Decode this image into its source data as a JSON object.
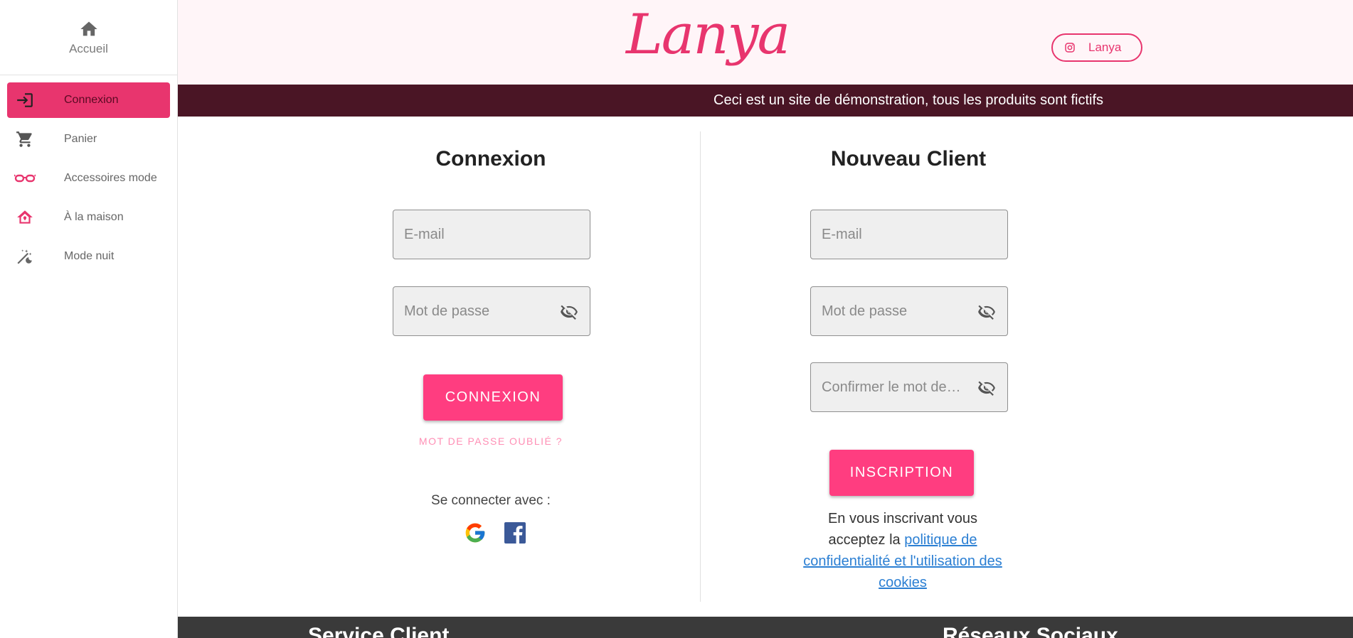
{
  "sidebar": {
    "home_label": "Accueil",
    "items": [
      {
        "label": "Connexion",
        "icon": "login-icon"
      },
      {
        "label": "Panier",
        "icon": "cart-icon"
      },
      {
        "label": "Accessoires mode",
        "icon": "glasses-icon"
      },
      {
        "label": "À la maison",
        "icon": "house-icon"
      },
      {
        "label": "Mode nuit",
        "icon": "night-mode-icon"
      }
    ]
  },
  "header": {
    "logo": "Lanya",
    "instagram_label": "Lanya",
    "banner": "Ceci est un site de démonstration, tous les produits sont fictifs"
  },
  "login": {
    "title": "Connexion",
    "email_placeholder": "E-mail",
    "password_placeholder": "Mot de passe",
    "submit_label": "CONNEXION",
    "forgot_label": "MOT DE PASSE OUBLIÉ ?",
    "connect_with": "Se connecter avec :"
  },
  "register": {
    "title": "Nouveau Client",
    "email_placeholder": "E-mail",
    "password_placeholder": "Mot de passe",
    "confirm_placeholder": "Confirmer le mot de…",
    "submit_label": "INSCRIPTION",
    "terms_prefix": "En vous inscrivant vous acceptez la ",
    "terms_link": "politique de confidentialité et l'utilisation des cookies"
  },
  "footer": {
    "col1": "Service Client",
    "col2": "Réseaux Sociaux"
  },
  "colors": {
    "accent": "#e8356e",
    "button": "#ff3d80",
    "banner": "#4a1525",
    "footer": "#3a3a3a"
  }
}
